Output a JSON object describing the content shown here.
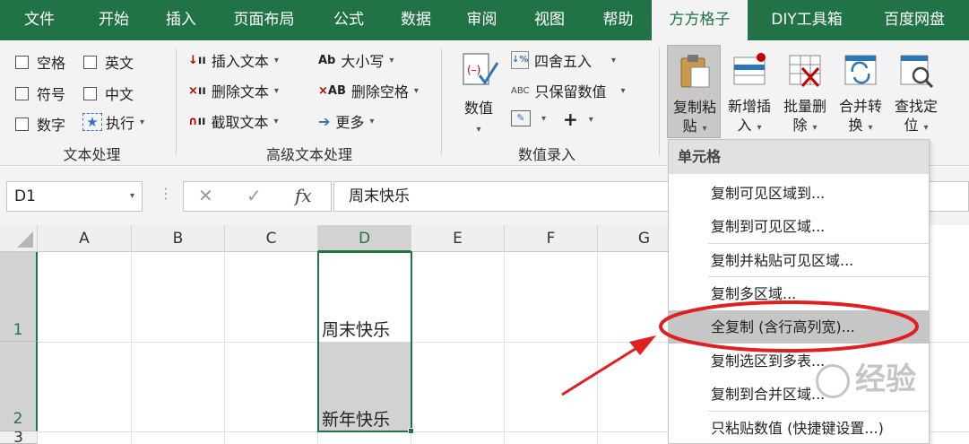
{
  "tabs": [
    "文件",
    "开始",
    "插入",
    "页面布局",
    "公式",
    "数据",
    "审阅",
    "视图",
    "帮助",
    "方方格子",
    "DIY工具箱",
    "百度网盘"
  ],
  "active_tab": "方方格子",
  "text_group": {
    "checkboxes": [
      "空格",
      "英文",
      "符号",
      "中文",
      "数字"
    ],
    "execute": "执行",
    "label": "文本处理"
  },
  "adv_text_group": {
    "insert": "插入文本",
    "delete": "删除文本",
    "extract": "截取文本",
    "case": "大小写",
    "remove_space": "删除空格",
    "more": "更多",
    "label": "高级文本处理"
  },
  "number_group": {
    "number": "数值",
    "round": "四舍五入",
    "keep_numbers": "只保留数值",
    "label": "数值录入"
  },
  "big_buttons": [
    {
      "label": "复制粘\n贴",
      "caret": true
    },
    {
      "label": "新增插\n入",
      "caret": true
    },
    {
      "label": "批量删\n除",
      "caret": true
    },
    {
      "label": "合并转\n换",
      "caret": true
    },
    {
      "label": "查找定\n位",
      "caret": true
    }
  ],
  "formula_bar": {
    "name_box": "D1",
    "formula": "周末快乐"
  },
  "grid": {
    "columns": [
      "A",
      "B",
      "C",
      "D",
      "E",
      "F",
      "G"
    ],
    "rows": [
      "1",
      "2",
      "3"
    ],
    "cells": {
      "D1": "周末快乐",
      "D2": "新年快乐"
    }
  },
  "menu": {
    "header": "单元格",
    "items": [
      "复制可见区域到...",
      "复制到可见区域...",
      "复制并粘贴可见区域...",
      "复制多区域...",
      "全复制 (含行高列宽)...",
      "复制选区到多表...",
      "复制到合并区域...",
      "只粘贴数值 (快捷键设置...)"
    ],
    "highlighted_index": 4
  },
  "watermark": "经验"
}
